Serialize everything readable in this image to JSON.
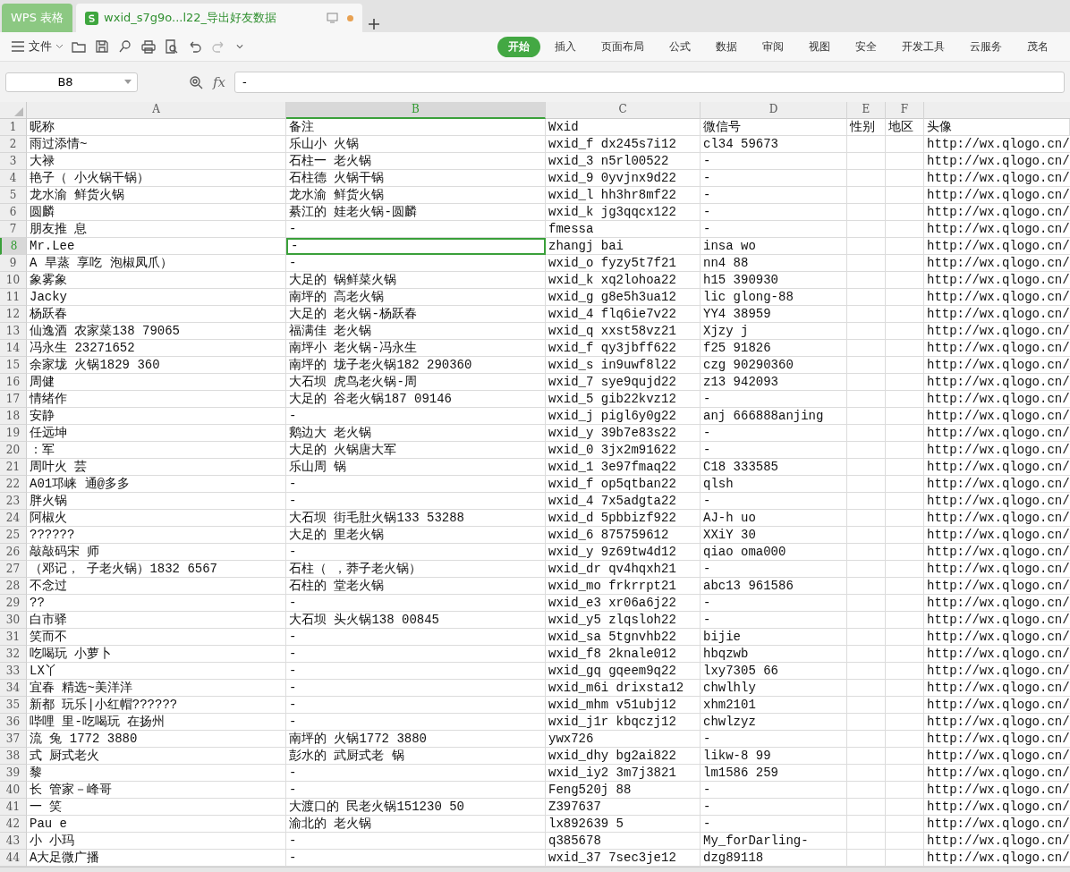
{
  "tabs": [
    {
      "label": "WPS 表格",
      "kind": "app",
      "selected": false
    },
    {
      "label": "wxid_s7g9o...l22_导出好友数据",
      "kind": "doc",
      "selected": true
    }
  ],
  "toolbar": {
    "file_menu": "文件"
  },
  "ribbon_tabs": [
    {
      "label": "开始",
      "selected": true
    },
    {
      "label": "插入",
      "selected": false
    },
    {
      "label": "页面布局",
      "selected": false
    },
    {
      "label": "公式",
      "selected": false
    },
    {
      "label": "数据",
      "selected": false
    },
    {
      "label": "审阅",
      "selected": false
    },
    {
      "label": "视图",
      "selected": false
    },
    {
      "label": "安全",
      "selected": false
    },
    {
      "label": "开发工具",
      "selected": false
    },
    {
      "label": "云服务",
      "selected": false
    },
    {
      "label": "茂名",
      "selected": false
    }
  ],
  "formula_bar": {
    "cell_ref": "B8",
    "fx": "fx",
    "value": "-"
  },
  "sheet": {
    "columns": [
      {
        "label": "A",
        "selected": false
      },
      {
        "label": "B",
        "selected": true
      },
      {
        "label": "C",
        "selected": false
      },
      {
        "label": "D",
        "selected": false
      },
      {
        "label": "E",
        "selected": false
      },
      {
        "label": "F",
        "selected": false
      }
    ],
    "rows": [
      {
        "number": "1",
        "selected": false,
        "cells": {
          "A": "昵称",
          "B": "备注",
          "C": "Wxid",
          "D": "微信号",
          "E": "性别",
          "F": "地区",
          "G": "头像"
        }
      },
      {
        "number": "2",
        "selected": false,
        "cells": {
          "A": "雨过添情~",
          "B": "乐山小 火锅",
          "C": "wxid_f dx245s7i12",
          "D": "cl34 59673",
          "G": "http://wx.qlogo.cn/"
        }
      },
      {
        "number": "3",
        "selected": false,
        "cells": {
          "A": "大禄",
          "B": "石柱一 老火锅",
          "C": "wxid_3 n5rl00522",
          "D": "-",
          "G": "http://wx.qlogo.cn/"
        }
      },
      {
        "number": "4",
        "selected": false,
        "cells": {
          "A": "艳子（ 小火锅干锅）",
          "B": "石柱德 火锅干锅",
          "C": "wxid_9 0yvjnx9d22",
          "D": "-",
          "G": "http://wx.qlogo.cn/"
        }
      },
      {
        "number": "5",
        "selected": false,
        "cells": {
          "A": "龙水渝 鲜货火锅",
          "B": "龙水渝 鲜货火锅",
          "C": "wxid_l hh3hr8mf22",
          "D": "-",
          "G": "http://wx.qlogo.cn/"
        }
      },
      {
        "number": "6",
        "selected": false,
        "cells": {
          "A": "圆麟",
          "B": "綦江的 娃老火锅-圆麟",
          "C": "wxid_k jg3qqcx122",
          "D": "-",
          "G": "http://wx.qlogo.cn/"
        }
      },
      {
        "number": "7",
        "selected": false,
        "cells": {
          "A": "朋友推 息",
          "B": "-",
          "C": "fmessa",
          "D": "-",
          "G": "http://wx.qlogo.cn/"
        }
      },
      {
        "number": "8",
        "selected": true,
        "cells": {
          "A": "Mr.Lee",
          "B": "-",
          "C": "zhangj bai",
          "D": "insa wo",
          "G": "http://wx.qlogo.cn/"
        }
      },
      {
        "number": "9",
        "selected": false,
        "cells": {
          "A": "A 旱蒸 享吃 泡椒凤爪）",
          "B": "-",
          "C": "wxid_o fyzy5t7f21",
          "D": "nn4 88",
          "G": "http://wx.qlogo.cn/"
        }
      },
      {
        "number": "10",
        "selected": false,
        "cells": {
          "A": "象雾象",
          "B": "大足的 锅鲜菜火锅",
          "C": "wxid_k xq2lohoa22",
          "D": "h15 390930",
          "G": "http://wx.qlogo.cn/"
        }
      },
      {
        "number": "11",
        "selected": false,
        "cells": {
          "A": "Jacky",
          "B": "南坪的 高老火锅",
          "C": "wxid_g g8e5h3ua12",
          "D": "lic glong-88",
          "G": "http://wx.qlogo.cn/"
        }
      },
      {
        "number": "12",
        "selected": false,
        "cells": {
          "A": "杨跃春",
          "B": "大足的 老火锅-杨跃春",
          "C": "wxid_4 flq6ie7v22",
          "D": "YY4 38959",
          "G": "http://wx.qlogo.cn/"
        }
      },
      {
        "number": "13",
        "selected": false,
        "cells": {
          "A": "仙逸酒 农家菜138 79065",
          "B": "福满佳 老火锅",
          "C": "wxid_q xxst58vz21",
          "D": "Xjzy j",
          "G": "http://wx.qlogo.cn/"
        }
      },
      {
        "number": "14",
        "selected": false,
        "cells": {
          "A": "冯永生 23271652",
          "B": "南坪小 老火锅-冯永生",
          "C": "wxid_f qy3jbff622",
          "D": "f25 91826",
          "G": "http://wx.qlogo.cn/"
        }
      },
      {
        "number": "15",
        "selected": false,
        "cells": {
          "A": "余家垅 火锅1829 360",
          "B": "南坪的 垅子老火锅182 290360",
          "C": "wxid_s in9uwf8l22",
          "D": "czg 90290360",
          "G": "http://wx.qlogo.cn/"
        }
      },
      {
        "number": "16",
        "selected": false,
        "cells": {
          "A": "周健",
          "B": "大石坝 虎鸟老火锅-周",
          "C": "wxid_7 sye9qujd22",
          "D": "z13 942093",
          "G": "http://wx.qlogo.cn/"
        }
      },
      {
        "number": "17",
        "selected": false,
        "cells": {
          "A": "情绪作",
          "B": "大足的 谷老火锅187 09146",
          "C": "wxid_5 gib22kvz12",
          "D": "-",
          "G": "http://wx.qlogo.cn/"
        }
      },
      {
        "number": "18",
        "selected": false,
        "cells": {
          "A": "安静",
          "B": "-",
          "C": "wxid_j pigl6y0g22",
          "D": "anj 666888anjing",
          "G": "http://wx.qlogo.cn/"
        }
      },
      {
        "number": "19",
        "selected": false,
        "cells": {
          "A": "任远坤",
          "B": "鹅边大 老火锅",
          "C": "wxid_y 39b7e83s22",
          "D": "-",
          "G": "http://wx.qlogo.cn/"
        }
      },
      {
        "number": "20",
        "selected": false,
        "cells": {
          "A": "：军",
          "B": "大足的 火锅唐大军",
          "C": "wxid_0 3jx2m91622",
          "D": "-",
          "G": "http://wx.qlogo.cn/"
        }
      },
      {
        "number": "21",
        "selected": false,
        "cells": {
          "A": "周叶火 芸",
          "B": "乐山周 锅",
          "C": "wxid_1 3e97fmaq22",
          "D": "C18 333585",
          "G": "http://wx.qlogo.cn/"
        }
      },
      {
        "number": "22",
        "selected": false,
        "cells": {
          "A": "A01邛崃 通@多多",
          "B": "-",
          "C": "wxid_f op5qtban22",
          "D": "qlsh",
          "G": "http://wx.qlogo.cn/"
        }
      },
      {
        "number": "23",
        "selected": false,
        "cells": {
          "A": "胖火锅",
          "B": "-",
          "C": "wxid_4 7x5adgta22",
          "D": "-",
          "G": "http://wx.qlogo.cn/"
        }
      },
      {
        "number": "24",
        "selected": false,
        "cells": {
          "A": "阿椒火",
          "B": "大石坝 街毛肚火锅133 53288",
          "C": "wxid_d 5pbbizf922",
          "D": "AJ-h uo",
          "G": "http://wx.qlogo.cn/"
        }
      },
      {
        "number": "25",
        "selected": false,
        "cells": {
          "A": "??????",
          "B": "大足的 里老火锅",
          "C": "wxid_6 875759612",
          "D": "XXiY 30",
          "G": "http://wx.qlogo.cn/"
        }
      },
      {
        "number": "26",
        "selected": false,
        "cells": {
          "A": "敲敲码宋 师",
          "B": "-",
          "C": "wxid_y 9z69tw4d12",
          "D": "qiao oma000",
          "G": "http://wx.qlogo.cn/"
        }
      },
      {
        "number": "27",
        "selected": false,
        "cells": {
          "A": "（邓记， 子老火锅）1832 6567",
          "B": "石柱（ ，莽子老火锅）",
          "C": "wxid_dr qv4hqxh21",
          "D": "-",
          "G": "http://wx.qlogo.cn/"
        }
      },
      {
        "number": "28",
        "selected": false,
        "cells": {
          "A": "不念过",
          "B": "石柱的 堂老火锅",
          "C": "wxid_mo frkrrpt21",
          "D": "abc13 961586",
          "G": "http://wx.qlogo.cn/"
        }
      },
      {
        "number": "29",
        "selected": false,
        "cells": {
          "A": "??",
          "B": "-",
          "C": "wxid_e3 xr06a6j22",
          "D": "-",
          "G": "http://wx.qlogo.cn/"
        }
      },
      {
        "number": "30",
        "selected": false,
        "cells": {
          "A": "白市驿",
          "B": "大石坝 头火锅138 00845",
          "C": "wxid_y5 zlqsloh22",
          "D": "-",
          "G": "http://wx.qlogo.cn/"
        }
      },
      {
        "number": "31",
        "selected": false,
        "cells": {
          "A": "笑而不",
          "B": "-",
          "C": "wxid_sa 5tgnvhb22",
          "D": "bijie",
          "G": "http://wx.qlogo.cn/"
        }
      },
      {
        "number": "32",
        "selected": false,
        "cells": {
          "A": "吃喝玩 小萝卜",
          "B": "-",
          "C": "wxid_f8 2knale012",
          "D": "hbqzwb",
          "G": "http://wx.qlogo.cn/"
        }
      },
      {
        "number": "33",
        "selected": false,
        "cells": {
          "A": "LX丫",
          "B": "-",
          "C": "wxid_gq gqeem9q22",
          "D": "lxy7305 66",
          "G": "http://wx.qlogo.cn/"
        }
      },
      {
        "number": "34",
        "selected": false,
        "cells": {
          "A": "宜春 精选~美洋洋",
          "B": "-",
          "C": "wxid_m6i drixsta12",
          "D": "chwlhly",
          "G": "http://wx.qlogo.cn/"
        }
      },
      {
        "number": "35",
        "selected": false,
        "cells": {
          "A": "新都 玩乐|小红帽??????",
          "B": "-",
          "C": "wxid_mhm v51ubj12",
          "D": "xhm2101",
          "G": "http://wx.qlogo.cn/"
        }
      },
      {
        "number": "36",
        "selected": false,
        "cells": {
          "A": "哔哩 里-吃喝玩 在扬州",
          "B": "-",
          "C": "wxid_j1r kbqczj12",
          "D": "chwlzyz",
          "G": "http://wx.qlogo.cn/"
        }
      },
      {
        "number": "37",
        "selected": false,
        "cells": {
          "A": "流 兔 1772 3880",
          "B": "南坪的 火锅1772 3880",
          "C": "ywx726",
          "D": "-",
          "G": "http://wx.qlogo.cn/"
        }
      },
      {
        "number": "38",
        "selected": false,
        "cells": {
          "A": "式 厨式老火",
          "B": "彭水的 武厨式老 锅",
          "C": "wxid_dhy bg2ai822",
          "D": "likw-8 99",
          "G": "http://wx.qlogo.cn/"
        }
      },
      {
        "number": "39",
        "selected": false,
        "cells": {
          "A": "黎",
          "B": "-",
          "C": "wxid_iy2 3m7j3821",
          "D": "lm1586 259",
          "G": "http://wx.qlogo.cn/"
        }
      },
      {
        "number": "40",
        "selected": false,
        "cells": {
          "A": "长 管家－峰哥",
          "B": "-",
          "C": "Feng520j 88",
          "D": "-",
          "G": "http://wx.qlogo.cn/"
        }
      },
      {
        "number": "41",
        "selected": false,
        "cells": {
          "A": "一 笑",
          "B": "大渡口的 民老火锅151230 50",
          "C": "Z397637",
          "D": "-",
          "G": "http://wx.qlogo.cn/"
        }
      },
      {
        "number": "42",
        "selected": false,
        "cells": {
          "A": "Pau e",
          "B": "渝北的 老火锅",
          "C": "lx892639 5",
          "D": "-",
          "G": "http://wx.qlogo.cn/"
        }
      },
      {
        "number": "43",
        "selected": false,
        "cells": {
          "A": "小 小玛",
          "B": "-",
          "C": "q385678",
          "D": "My_forDarling-",
          "G": "http://wx.qlogo.cn/"
        }
      },
      {
        "number": "44",
        "selected": false,
        "cells": {
          "A": "A大足微广播",
          "B": "-",
          "C": "wxid_37 7sec3je12",
          "D": "dzg89118",
          "G": "http://wx.qlogo.cn/"
        }
      }
    ]
  }
}
